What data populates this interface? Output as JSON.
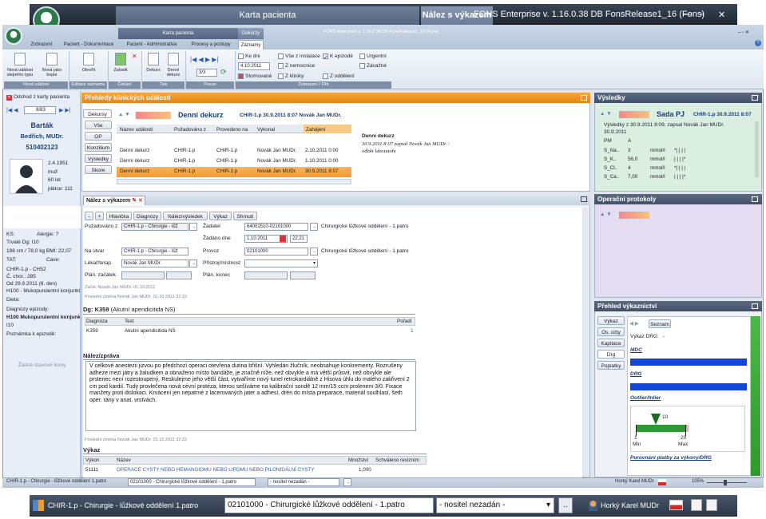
{
  "outer": {
    "tab_patient": "Karta pacienta",
    "tab_finding": "Nález s výkazem",
    "title": "FONS Enterprise v. 1.16.0.38 DB FonsRelease1_16 (Fons)",
    "win_min": "—",
    "win_max": "▫",
    "win_close": "✕"
  },
  "app": {
    "title": "FONS Enterprise v. 1.16.0.38 DB FonsRelease1_16 (Fons)",
    "win_controls": "–  ▫  ✕",
    "help": "?"
  },
  "ribbon_tabs": [
    "Zobrazení",
    "Pacient - Dokumentace",
    "Pacient - Administrativa",
    "Procesy a postupy",
    "Záznamy"
  ],
  "ribbon_groups_top": {
    "karta": "Karta pacienta",
    "dekurzy": "Dekurzy"
  },
  "ribbon": {
    "new_event": "Nová událost stejného typu",
    "new_copy": "Nová jako kopie",
    "open": "Otevřít",
    "assign": "Zařadit",
    "print_dekurs": "Dekurs",
    "print_dekurz": "Denní dekurz",
    "nav_counter": "3/3",
    "g_new": "Nová událost",
    "g_edit": "Editace záznamu",
    "g_class": "Čekání",
    "g_print": "Tisk",
    "g_move": "Posun",
    "g_filter": "Zobrazení / Filtr",
    "f_ke_dni": "Ke dni",
    "f_date": "4.10.2011",
    "f_storno": "Stornované",
    "f_vse": "Vše z instalace",
    "f_nemocnice": "Z nemocnice",
    "f_kliniky": "Z kliniky",
    "f_k_epizode": "K epizodě",
    "f_oddeleni": "Z oddělení",
    "f_urgentni": "Urgentní",
    "f_zavazne": "Závažné"
  },
  "left": {
    "back": "Odchod z karty pacienta",
    "counter": "8/83",
    "surname": "Barták",
    "name": "Bedřich, MUDr.",
    "id": "510402123",
    "dob": "2.4.1951",
    "sex": "muž",
    "age": "60 let",
    "payer": "plátce: 111",
    "ks": "KS:",
    "allergy": "Alergie: ?",
    "dg": "Trvalé Dg: I10",
    "body": "188 cm / 78,0 kg  BMI: 22,07",
    "tat": "TAT:",
    "cave": "Cave:",
    "ward": "CHIR-1.p - CH52",
    "chor": "Č. chor.: 285",
    "since": "Od 29.9.2011 (6. den)",
    "diag1": "H100 - Mukopurulentní konjunkt",
    "dieta": "Dieta:",
    "ep_dg": "Diagnózy epizody:",
    "ep_dg1": "H100 Mukopurulentní konjunkt",
    "ep_dg2": "I10",
    "note": "Poznámka k epizodě:",
    "nostatus": "Žádné stavové ikony"
  },
  "events": {
    "header": "Přehledy klinických událostí",
    "tabs": [
      "Dekursy",
      "Vše",
      "OP",
      "Konzilium",
      "Výsledky",
      "Skore"
    ],
    "title": "Denní dekurz",
    "title_meta": "CHIR-1.p  30.9.2011 8:07  Novák Jan MUDr.",
    "columns": [
      "Název události",
      "Požadováno z",
      "Provedeno na",
      "Vykonal",
      "Zahájení"
    ],
    "rows": [
      [
        "Denní dekurz",
        "CHIR-1.p",
        "CHIR-1.p",
        "Novák Jan MUDr.",
        "2.10.2011 0:00"
      ],
      [
        "Denní dekurz",
        "CHIR-1.p",
        "CHIR-1.p",
        "Novák Jan MUDr.",
        "1.10.2011 0:00"
      ],
      [
        "Denní dekurz",
        "CHIR-1.p",
        "CHIR-1.p",
        "Novák Jan MUDr.",
        "30.9.2011 8:07"
      ]
    ],
    "preview_title": "Denní dekurz",
    "preview_meta": "30.9.2011 8:07 zapsal Novák Jan MUDr. :",
    "preview_text": "odběr laboratoře"
  },
  "finding": {
    "tab": "Nález s výkazem",
    "toolbar": [
      "-",
      "+",
      "Hlavička",
      "Diagnózy",
      "Nález/výsledek",
      "Výkaz",
      "Shrnutí"
    ],
    "req_label": "Požadováno z",
    "req_val": "CHIR-1.p - Chirurgie - lůž",
    "zadatel_label": "Žadatel",
    "zadatel_val": "64001510-02101000",
    "zadatel_desc": "Chirurgické lůžkové oddělení - 1.patro",
    "zadano_label": "Žádáno dne",
    "zadano_date": "1.10.2011",
    "zadano_time": "22:21",
    "naut_label": "Na útvar",
    "naut_val": "CHIR-1.p - Chirurgie - lůž",
    "provoz_label": "Provoz",
    "provoz_val": "02101000",
    "provoz_desc": "Chirurgické lůžkové oddělení - 1.patro",
    "lekar_label": "Lékař/terap.",
    "lekar_val": "Novák Jan MUDr.",
    "pristroj_label": "Přístroj/místnost",
    "plan_z": "Plán. začátek",
    "plan_k": "Plán. konec",
    "zacal": "Začal:    Novák Jan MUDr.   01.10.2011",
    "zmena1": "Poslední změna    Novák Jan MUDr.   01.10.2011    22:22",
    "dg_code": "Dg: K359",
    "dg_text": "(Akutní apendicitida NS)",
    "dg_cols": [
      "Diagnóza",
      "Text",
      "Pořadí"
    ],
    "dg_row": [
      "K359",
      "Akutní apendicitida NS",
      "1"
    ],
    "nalez_header": "Nález/zpráva",
    "nalez_text": "V celkové anestezii jizvou po předchozí operaci otevřena dutina břišní. Vyhledán žlučník, neobsahuje konkrementy. Rozrušeny adheze mezi játry a žaludkem a obnaženo místo bandáže, je značně níže, než obvykle a má větší průsvit, než obvykle ale prstenec není rozestoupený. Reskulejme jeho větší část, vytvaříme nový tunel retrokardiálně z Hisova úhlu do malého zakřivení 2 cm pod kardií. Tudy provlečena nová cévní protéza, kterou sešíváme na kalibrační sondě 12 mm/15 ccm prolenem 3/0. Fixace manžety proti dislokaci. Krvácení jen nepatrné z lacerovaných jater a adhesí, drén do místa preparace, materiál soulhlasí, šeth oper. rány v anat. vrstvách.",
    "zmena2": "Poslední změna    Novák Jan MUDr.   01.10.2011    22:22",
    "vykaz_header": "Výkaz",
    "vykaz_cols": [
      "Výkon",
      "Název",
      "Množství",
      "Schváleno revizním"
    ],
    "vykaz_row": [
      "51111",
      "OPERACE CYSTY NEBO HEMANGIOMU NEBO LIPOMU NEBO PILONIDÁLNÍ CYSTY",
      "1,000"
    ]
  },
  "results": {
    "header": "Výsledky",
    "patient": "Sada PJ",
    "meta": "CHIR-1.p  30.9.2011 8:07",
    "line1": "Výsledky z 30.9.2011 8:09, zapsal Novák Jan MUDr.",
    "line2": "30.9.2011",
    "pm": "PM",
    "a": "A",
    "rows": [
      [
        "S_Na..",
        "3",
        "mmol/l",
        "*|   |   |   |"
      ],
      [
        "S_K..",
        "56,0",
        "mmol/l",
        "|   |   |   |*"
      ],
      [
        "S_Cl..",
        "4",
        "mmol/l",
        "*|   |   |   |"
      ],
      [
        "S_Ca..",
        "7,00",
        "mmol/l",
        "|   |   |   |*"
      ]
    ]
  },
  "ops": {
    "header": "Operační protokoly"
  },
  "perf": {
    "header": "Přehled výkaznictví",
    "tabs": [
      "Výkaz",
      "Os. účty",
      "Kapitace",
      "Drg",
      "Poplatky"
    ],
    "list_btn": "Seznam",
    "drg_label": "Výkaz DRG:",
    "mdc": "MDC",
    "drg": "DRG",
    "outlier": "Outlier/Inlier",
    "marker": "10",
    "min_val": "1",
    "max_val": "20",
    "min_lbl": "Min",
    "max_lbl": "Max",
    "porovnani": "Porovnání platby za výkony/DRG"
  },
  "status_inner": {
    "ward": "CHIR-1.p - Chirurgie - lůžkové oddělení 1.patro",
    "provoz": "02101000 - Chirurgické lůžkové oddělení - 1.patro",
    "nositel": "- nositel nezadán -",
    "user": "Horký Karel MUDr.",
    "zoom": "105%"
  },
  "status_outer": {
    "ward": "CHIR-1.p - Chirurgie - lůžkové oddělení 1.patro",
    "provoz": "02101000 - Chirurgické lůžkové oddělení - 1.patro",
    "nositel": "- nositel nezadán -",
    "user": "Horký Karel MUDr"
  }
}
